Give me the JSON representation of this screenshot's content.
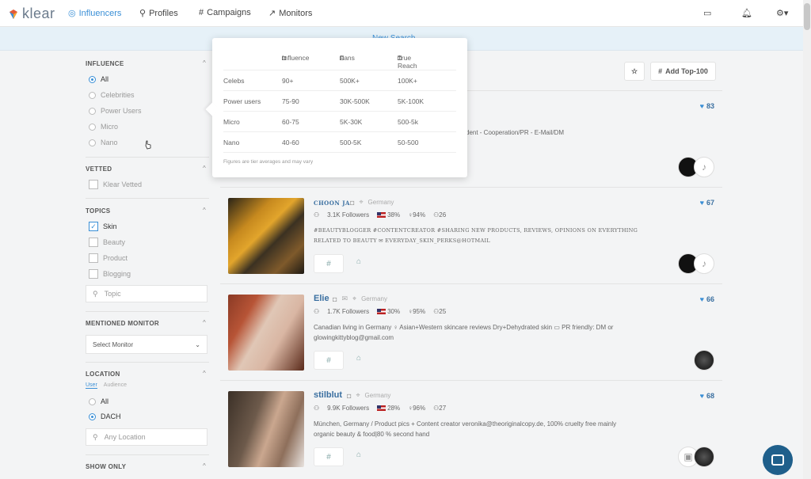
{
  "nav": {
    "logo": "klear",
    "items": [
      {
        "label": "Influencers",
        "icon": "influencer-icon"
      },
      {
        "label": "Profiles",
        "icon": "person-icon"
      },
      {
        "label": "Campaigns",
        "icon": "hash-icon"
      },
      {
        "label": "Monitors",
        "icon": "chart-icon"
      }
    ],
    "accent": "#3a8fd6"
  },
  "banner": {
    "label": "New Search"
  },
  "popup": {
    "headers": [
      "Influence",
      "Fans",
      "True Reach"
    ],
    "rows": [
      {
        "tier": "Celebs",
        "influence": "90+",
        "fans": "500K+",
        "reach": "100K+"
      },
      {
        "tier": "Power users",
        "influence": "75-90",
        "fans": "30K-500K",
        "reach": "5K-100K"
      },
      {
        "tier": "Micro",
        "influence": "60-75",
        "fans": "5K-30K",
        "reach": "500-5k"
      },
      {
        "tier": "Nano",
        "influence": "40-60",
        "fans": "500-5K",
        "reach": "50-500"
      }
    ],
    "note": "Figures are tier averages and may vary"
  },
  "sidebar": {
    "influence": {
      "title": "INFLUENCE",
      "options": [
        "All",
        "Celebrities",
        "Power Users",
        "Micro",
        "Nano"
      ],
      "selected": "All"
    },
    "vetted": {
      "title": "VETTED",
      "option": "Klear Vetted"
    },
    "topics": {
      "title": "TOPICS",
      "options": [
        "Skin",
        "Beauty",
        "Product",
        "Blogging"
      ],
      "checked": "Skin",
      "placeholder": "Topic"
    },
    "monitor": {
      "title": "MENTIONED MONITOR",
      "select": "Select Monitor"
    },
    "location": {
      "title": "LOCATION",
      "tab_user": "User",
      "tab_audience": "Audience",
      "options": [
        "All",
        "DACH"
      ],
      "selected": "DACH",
      "placeholder": "Any Location"
    },
    "show_only": {
      "title": "SHOW ONLY"
    }
  },
  "toolbar": {
    "add_top": "Add Top-100"
  },
  "cards": [
    {
      "score": "83",
      "bio_partial": "dent - Cooperation/PR - E-Mail/DM"
    },
    {
      "name": "CHOON JA",
      "country": "Germany",
      "followers": "3.1K Followers",
      "flag_pct": "38%",
      "gender_pct": "94%",
      "age": "26",
      "bio": "#BEAUTYBLOGGER #CONTENTCREATOR #SHARING NEW PRODUCTS, REVIEWS, OPINIONS ON EVERYTHING RELATED TO BEAUTY ✉ EVERYDAY_SKIN_PERKS@HOTMAIL",
      "score": "67"
    },
    {
      "name": "Elie",
      "country": "Germany",
      "followers": "1.7K Followers",
      "flag_pct": "30%",
      "gender_pct": "95%",
      "age": "25",
      "bio": "Canadian living in Germany ♀ Asian+Western skincare reviews Dry+Dehydrated skin ▭ PR friendly: DM or glowingkittyblog@gmail.com",
      "score": "66"
    },
    {
      "name": "stilblut",
      "country": "Germany",
      "followers": "9.9K Followers",
      "flag_pct": "28%",
      "gender_pct": "96%",
      "age": "27",
      "bio": "München, Germany / Product pics + Content creator veronika@theoriginalcopy.de, 100% cruelty free mainly organic beauty & food|80 % second hand",
      "score": "68"
    }
  ]
}
